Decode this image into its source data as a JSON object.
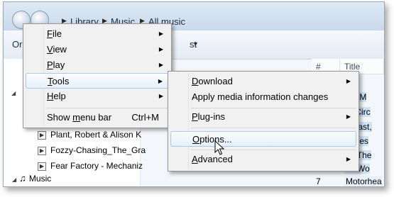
{
  "breadcrumb": [
    "Library",
    "Music",
    "All music"
  ],
  "toolbar": {
    "frag_left": "Or",
    "frag_right": "st"
  },
  "columns": {
    "num": "#",
    "title": "Title"
  },
  "nav_items": [
    {
      "label": "Plant, Robert & Alison K"
    },
    {
      "label": "Fozzy-Chasing_The_Gra"
    },
    {
      "label": "Fear Factory - Mechaniz"
    }
  ],
  "nav_music": "Music",
  "right_cells": [
    "tric M",
    "nt Circ",
    "e Fast,",
    "ashes",
    "ve The",
    "se Wo"
  ],
  "last_row": {
    "num": "7",
    "title": "Motorhea"
  },
  "main_menu": [
    {
      "label": "File",
      "accel": "F",
      "rest": "ile",
      "submenu": true
    },
    {
      "label": "View",
      "accel": "V",
      "rest": "iew",
      "submenu": true
    },
    {
      "label": "Play",
      "accel": "P",
      "rest": "lay",
      "submenu": true
    },
    {
      "label": "Tools",
      "accel": "T",
      "rest": "ools",
      "submenu": true,
      "highlighted": true
    },
    {
      "label": "Help",
      "accel": "H",
      "rest": "elp",
      "submenu": true
    },
    {
      "label": "Show menu bar",
      "pre": "Show ",
      "accel": "m",
      "rest": "enu bar",
      "shortcut": "Ctrl+M"
    }
  ],
  "tools_menu": [
    {
      "label": "Download",
      "accel": "D",
      "rest": "ownload",
      "submenu": true
    },
    {
      "label": "Apply media information changes"
    },
    {
      "label": "Plug-ins",
      "accel": "P",
      "rest": "lug-ins",
      "submenu": true
    },
    {
      "label": "Options...",
      "accel": "O",
      "rest": "ptions...",
      "highlighted": true
    },
    {
      "label": "Advanced",
      "accel": "A",
      "rest": "dvanced",
      "submenu": true
    }
  ]
}
